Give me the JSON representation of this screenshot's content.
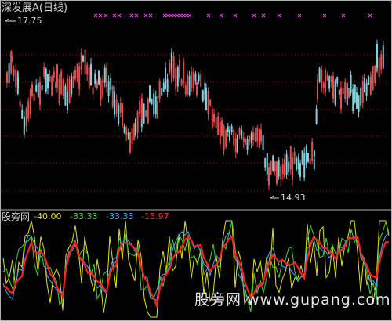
{
  "header": {
    "title": "深发展A(日线)"
  },
  "price_chart": {
    "high_label": "17.75",
    "low_label": "14.93",
    "colors": {
      "up": "#e05050",
      "down": "#7fd0e0",
      "marker": "#e040e0",
      "grid": "#a01010",
      "arrow": "#d8d8d8"
    }
  },
  "indicator": {
    "name": "股旁网",
    "values": [
      {
        "text": "-40.00",
        "color": "#e6e600"
      },
      {
        "text": "-33.33",
        "color": "#3fd63f"
      },
      {
        "text": "-33.33",
        "color": "#4aa6ff"
      },
      {
        "text": "-15.97",
        "color": "#ff3030"
      }
    ],
    "line_colors": {
      "yellow": "#e6e600",
      "green": "#3fd63f",
      "blue": "#4aa6ff",
      "red": "#ff2020"
    }
  },
  "watermark": "股旁网 www.gupang.com"
}
